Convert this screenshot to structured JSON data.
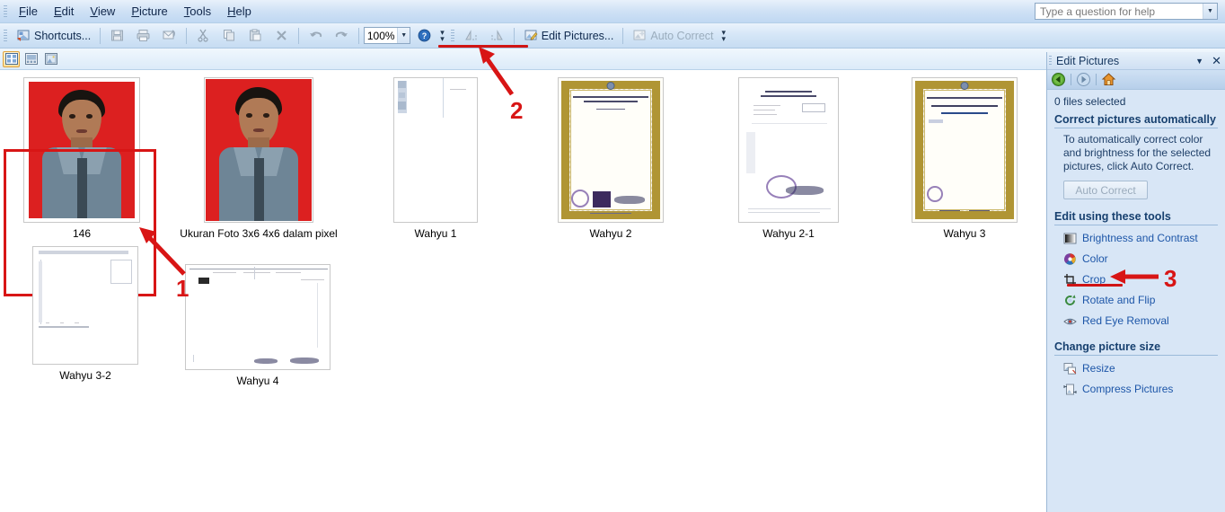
{
  "menu": {
    "items": [
      {
        "label": "File",
        "accel": "F"
      },
      {
        "label": "Edit",
        "accel": "E"
      },
      {
        "label": "View",
        "accel": "V"
      },
      {
        "label": "Picture",
        "accel": "P"
      },
      {
        "label": "Tools",
        "accel": "T"
      },
      {
        "label": "Help",
        "accel": "H"
      }
    ],
    "help_search_placeholder": "Type a question for help"
  },
  "toolbar": {
    "shortcuts_label": "Shortcuts...",
    "zoom_value": "100%",
    "edit_pictures_label": "Edit Pictures...",
    "auto_correct_label": "Auto Correct",
    "icons": [
      "shortcuts-icon",
      "save-icon",
      "print-icon",
      "email-icon",
      "cut-icon",
      "copy-icon",
      "paste-icon",
      "delete-icon",
      "undo-icon",
      "redo-icon",
      "help-icon",
      "rotate-left-icon",
      "rotate-right-icon",
      "edit-pictures-icon",
      "auto-correct-icon"
    ]
  },
  "viewbar": {
    "buttons": [
      {
        "name": "thumbnail-view-button",
        "active": true
      },
      {
        "name": "filmstrip-view-button",
        "active": false
      },
      {
        "name": "single-picture-view-button",
        "active": false
      }
    ]
  },
  "thumbnails": [
    {
      "caption": "146",
      "kind": "photo",
      "selected": true
    },
    {
      "caption": "Ukuran Foto 3x6 4x6 dalam pixel",
      "kind": "photo",
      "selected": false
    },
    {
      "caption": "Wahyu 1",
      "kind": "blank-doc",
      "selected": false
    },
    {
      "caption": "Wahyu 2",
      "kind": "certificate",
      "selected": false
    },
    {
      "caption": "Wahyu 2-1",
      "kind": "letter-doc",
      "selected": false
    },
    {
      "caption": "Wahyu 3",
      "kind": "certificate",
      "selected": false
    },
    {
      "caption": "Wahyu 3-2",
      "kind": "form-doc",
      "selected": false
    },
    {
      "caption": "Wahyu 4",
      "kind": "landscape-doc",
      "selected": false
    }
  ],
  "taskpane": {
    "title": "Edit Pictures",
    "nav": [
      "back-icon",
      "forward-icon",
      "home-icon"
    ],
    "files_selected": "0 files selected",
    "section_correct": "Correct pictures automatically",
    "auto_description": "To automatically correct color and brightness for the selected pictures, click Auto Correct.",
    "auto_correct_button": "Auto Correct",
    "section_tools": "Edit using these tools",
    "tools": [
      {
        "label": "Brightness and Contrast",
        "icon": "brightness-contrast-icon"
      },
      {
        "label": "Color",
        "icon": "color-wheel-icon"
      },
      {
        "label": "Crop",
        "icon": "crop-icon"
      },
      {
        "label": "Rotate and Flip",
        "icon": "rotate-flip-icon"
      },
      {
        "label": "Red Eye Removal",
        "icon": "red-eye-icon"
      }
    ],
    "section_size": "Change picture size",
    "size_tools": [
      {
        "label": "Resize",
        "icon": "resize-icon"
      },
      {
        "label": "Compress Pictures",
        "icon": "compress-icon"
      }
    ]
  },
  "annotations": {
    "color": "#d81515",
    "items": [
      {
        "number": "1",
        "target": "selected-thumbnail"
      },
      {
        "number": "2",
        "target": "edit-pictures-toolbar-button"
      },
      {
        "number": "3",
        "target": "crop-tool"
      }
    ]
  }
}
